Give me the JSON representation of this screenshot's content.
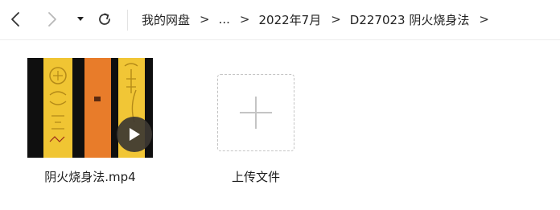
{
  "navigation": {
    "back_icon": "chevron-left-icon",
    "forward_icon": "chevron-right-icon",
    "history_dropdown_icon": "caret-down-icon",
    "refresh_icon": "refresh-icon"
  },
  "breadcrumb": {
    "items": [
      "我的网盘",
      "...",
      "2022年7月",
      "D227023 阴火烧身法"
    ],
    "separator": ">"
  },
  "files": [
    {
      "name": "阴火烧身法.mp4",
      "type": "video",
      "thumbnail_colors": [
        "#f0c533",
        "#e87c2a",
        "#f1c636"
      ],
      "overlay_icon": "play-icon"
    }
  ],
  "upload": {
    "label": "上传文件",
    "icon": "plus-icon"
  },
  "colors": {
    "background": "#ffffff",
    "divider": "#ececec",
    "text": "#222222",
    "icon": "#333333",
    "disabled_icon": "#b8b8b8",
    "upload_border": "#c4c4c4"
  }
}
